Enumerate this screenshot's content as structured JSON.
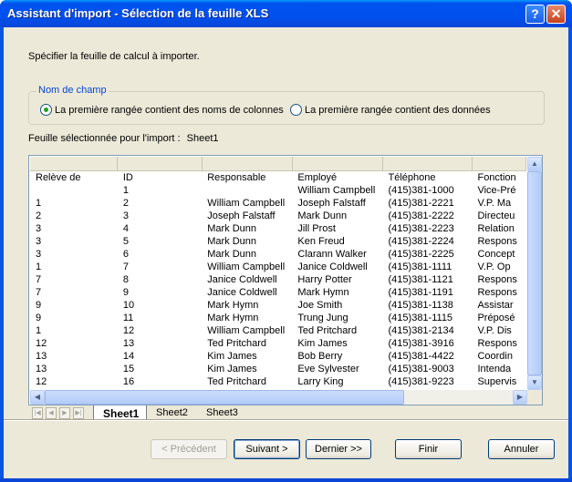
{
  "window": {
    "title": "Assistant d'import - Sélection de la feuille XLS",
    "help_label": "?",
    "close_label": "✕"
  },
  "instruction": "Spécifier la feuille de calcul à importer.",
  "field_group": {
    "title": "Nom de champ",
    "options": [
      {
        "label": "La première rangée contient des noms de colonnes",
        "selected": true
      },
      {
        "label": "La première rangée contient des données",
        "selected": false
      }
    ]
  },
  "selected_sheet": {
    "label": "Feuille sélectionnée pour l'import :",
    "value": "Sheet1"
  },
  "grid": {
    "columns": [
      "Relève de",
      "ID",
      "Responsable",
      "Employé",
      "Téléphone",
      "Fonction"
    ],
    "rows": [
      [
        "",
        "1",
        "",
        "William Campbell",
        "(415)381-1000",
        "Vice-Pré"
      ],
      [
        "1",
        "2",
        "William Campbell",
        "Joseph Falstaff",
        "(415)381-2221",
        "V.P. Ma"
      ],
      [
        "2",
        "3",
        "Joseph Falstaff",
        "Mark Dunn",
        "(415)381-2222",
        "Directeu"
      ],
      [
        "3",
        "4",
        "Mark Dunn",
        "Jill Prost",
        "(415)381-2223",
        "Relation"
      ],
      [
        "3",
        "5",
        "Mark Dunn",
        "Ken Freud",
        "(415)381-2224",
        "Respons"
      ],
      [
        "3",
        "6",
        "Mark Dunn",
        "Clarann Walker",
        "(415)381-2225",
        "Concept"
      ],
      [
        "1",
        "7",
        "William Campbell",
        "Janice Coldwell",
        "(415)381-1111",
        "V.P. Op"
      ],
      [
        "7",
        "8",
        "Janice Coldwell",
        "Harry Potter",
        "(415)381-1121",
        "Respons"
      ],
      [
        "7",
        "9",
        "Janice Coldwell",
        "Mark Hymn",
        "(415)381-1191",
        "Respons"
      ],
      [
        "9",
        "10",
        "Mark Hymn",
        "Joe Smith",
        "(415)381-1138",
        "Assistar"
      ],
      [
        "9",
        "11",
        "Mark Hymn",
        "Trung Jung",
        "(415)381-1115",
        "Préposé"
      ],
      [
        "1",
        "12",
        "William Campbell",
        "Ted Pritchard",
        "(415)381-2134",
        "V.P. Dis"
      ],
      [
        "12",
        "13",
        "Ted Pritchard",
        "Kim James",
        "(415)381-3916",
        "Respons"
      ],
      [
        "13",
        "14",
        "Kim James",
        "Bob Berry",
        "(415)381-4422",
        "Coordin"
      ],
      [
        "13",
        "15",
        "Kim James",
        "Eve Sylvester",
        "(415)381-9003",
        "Intenda"
      ],
      [
        "12",
        "16",
        "Ted Pritchard",
        "Larry King",
        "(415)381-9223",
        "Supervis"
      ]
    ]
  },
  "sheets": {
    "nav": [
      "|◀",
      "◀",
      "▶",
      "▶|"
    ],
    "tabs": [
      "Sheet1",
      "Sheet2",
      "Sheet3"
    ],
    "active_index": 0
  },
  "buttons": {
    "previous": "< Précédent",
    "next": "Suivant >",
    "last": "Dernier >>",
    "finish": "Finir",
    "cancel": "Annuler"
  }
}
